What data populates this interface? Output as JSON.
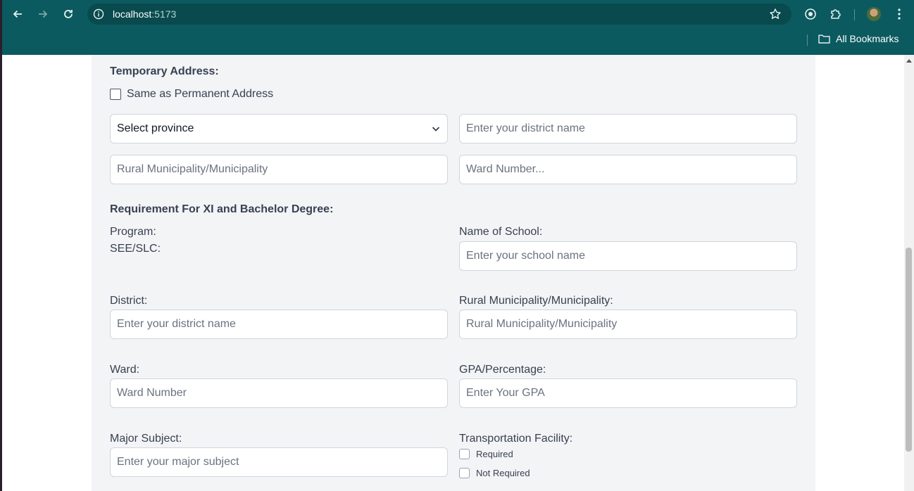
{
  "browser": {
    "url_host": "localhost",
    "url_port": ":5173",
    "bookmarks_label": "All Bookmarks"
  },
  "temporary_address": {
    "title": "Temporary Address:",
    "same_as_label": "Same as Permanent Address",
    "province_select": "Select province",
    "district_placeholder": "Enter your district name",
    "municipality_placeholder": "Rural Municipality/Municipality",
    "ward_placeholder": "Ward Number..."
  },
  "requirement": {
    "title": "Requirement For XI and Bachelor Degree:",
    "program_label": "Program:",
    "program_value": "SEE/SLC:",
    "school_label": "Name of School:",
    "school_placeholder": "Enter your school name",
    "district_label": "District:",
    "district_placeholder": "Enter your district name",
    "municipality_label": "Rural Municipality/Municipality:",
    "municipality_placeholder": "Rural Municipality/Municipality",
    "ward_label": "Ward:",
    "ward_placeholder": "Ward Number",
    "gpa_label": "GPA/Percentage:",
    "gpa_placeholder": "Enter Your GPA",
    "major_label": "Major Subject:",
    "major_placeholder": "Enter your major subject",
    "transport_label": "Transportation Facility:",
    "transport_options": [
      "Required",
      "Not Required"
    ]
  }
}
